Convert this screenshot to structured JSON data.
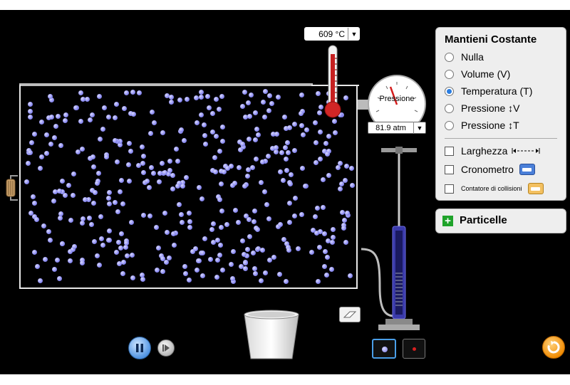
{
  "thermometer": {
    "value": "609 °C"
  },
  "gauge": {
    "label": "Pressione",
    "value": "81.9 atm"
  },
  "hold_constant": {
    "title": "Mantieni Costante",
    "options": [
      {
        "label": "Nulla",
        "selected": false
      },
      {
        "label": "Volume (V)",
        "selected": false
      },
      {
        "label": "Temperatura (T)",
        "selected": true
      },
      {
        "label": "Pressione ↕V",
        "selected": false
      },
      {
        "label": "Pressione ↕T",
        "selected": false
      }
    ],
    "tools": [
      {
        "label": "Larghezza",
        "checked": false,
        "icon": "width-arrow-icon"
      },
      {
        "label": "Cronometro",
        "checked": false,
        "icon": "stopwatch-icon"
      },
      {
        "label": "Contatore di collisioni",
        "checked": false,
        "icon": "collision-counter-icon"
      }
    ]
  },
  "particles_panel": {
    "label": "Particelle"
  },
  "controls": {
    "pause": "pause-icon",
    "step": "step-icon",
    "reset": "reset-icon"
  },
  "colors": {
    "particle": "#8a8af0",
    "accent": "#4a90e2",
    "reset": "#f08a00",
    "plus": "#1fa32a"
  }
}
